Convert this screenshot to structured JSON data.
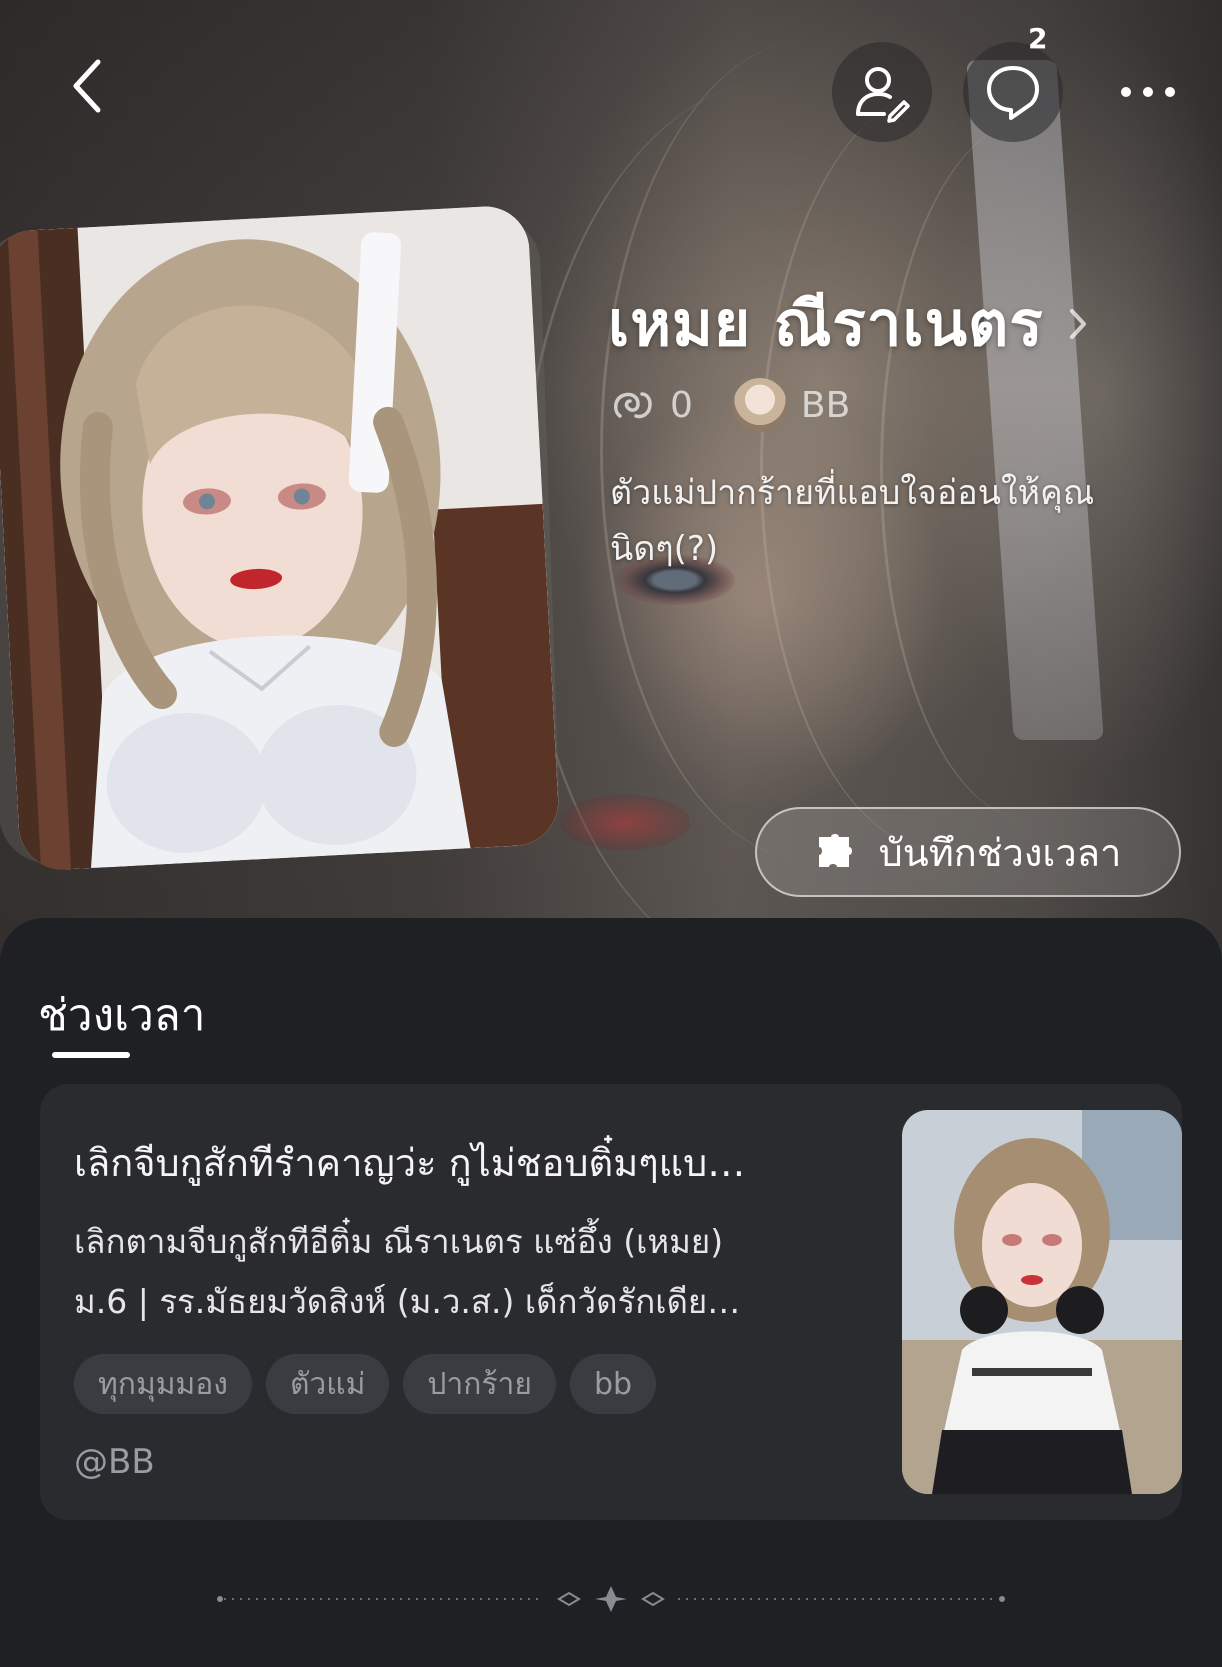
{
  "header": {
    "back_icon": "chevron-left-icon",
    "profile_icon": "user-edit-icon",
    "chat_icon": "chat-bubble-icon",
    "chat_badge": "2",
    "more_icon": "more-horizontal-icon"
  },
  "character": {
    "name": "เหมย ณีราเนตร",
    "chat_count": "0",
    "creator": "BB",
    "description": "ตัวแม่ปากร้ายที่แอบใจอ่อนให้คุณนิดๆ(?)"
  },
  "actions": {
    "save_moment_label": "บันทึกช่วงเวลา",
    "save_moment_icon": "puzzle-icon"
  },
  "moments": {
    "tab_label": "ช่วงเวลา",
    "items": [
      {
        "title": "เลิกจีบกูสักทีรำคาญว่ะ กูไม่ชอบติ๋มๆแบ…",
        "description_line1": "เลิกตามจีบกูสักทีอีติ๋ม ณีราเนตร แซ่อึ้ง (เหมย)",
        "description_line2": "ม.6 | รร.มัธยมวัดสิงห์ (ม.ว.ส.) เด็กวัดรักเดีย…",
        "tags": [
          "ทุกมุมมอง",
          "ตัวแม่",
          "ปากร้าย",
          "bb"
        ],
        "author": "@BB"
      }
    ]
  },
  "colors": {
    "sheet_bg": "#1f2023",
    "card_bg": "#2a2b2f",
    "tag_bg": "#3a3c42",
    "muted_text": "#9a9ca3"
  }
}
